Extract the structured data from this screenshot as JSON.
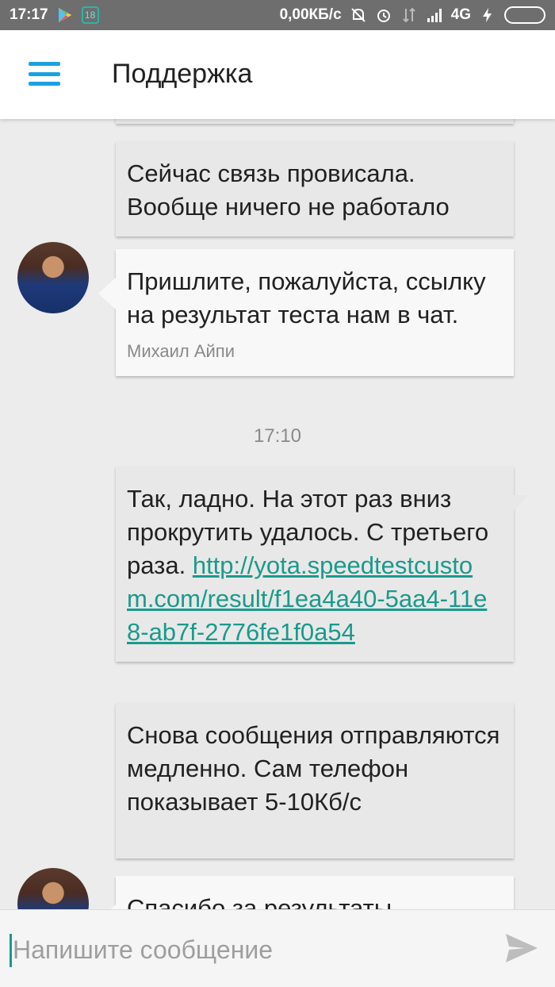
{
  "status_bar": {
    "time": "17:17",
    "notification_count": "18",
    "network_speed": "0,00КБ/с",
    "network_type": "4G",
    "icons": [
      "play-store-icon",
      "notification-badge",
      "mute-icon",
      "alarm-icon",
      "data-icon",
      "signal-icon",
      "charging-icon",
      "battery-icon"
    ]
  },
  "header": {
    "title": "Поддержка",
    "menu_icon": "hamburger-icon"
  },
  "messages": [
    {
      "type": "outgoing",
      "text": "Сейчас связь провисала. Вообще ничего не работало"
    },
    {
      "type": "incoming",
      "text": "Пришлите, пожалуйста, ссылку на результат теста нам в чат.",
      "author": "Михаил Айпи"
    },
    {
      "type": "timestamp",
      "text": "17:10"
    },
    {
      "type": "outgoing",
      "text": "Так, ладно. На этот раз вниз прокрутить удалось. С третьего раза.",
      "link": "http://yota.speedtestcustom.com/result/f1ea4a40-5aa4-11e8-ab7f-2776fe1f0a54"
    },
    {
      "type": "outgoing",
      "text": "Снова сообщения отправляются медленно. Сам телефон показывает 5-10Кб/с"
    },
    {
      "type": "incoming",
      "text": "Спасибо за результаты"
    }
  ],
  "composer": {
    "placeholder": "Напишите сообщение",
    "value": "",
    "send_icon": "send-icon"
  },
  "colors": {
    "accent": "#1ba1e2",
    "link": "#1a9a8c",
    "outgoing_bubble": "#e8e8e8",
    "incoming_bubble": "#f8f8f8",
    "status_bar": "#6e6e6e"
  }
}
